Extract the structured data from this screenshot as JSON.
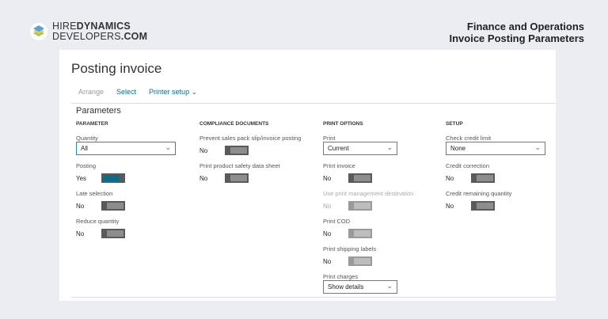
{
  "brand": {
    "line1_light": "HIRE",
    "line1_bold": "DYNAMICS",
    "line2_light": "DEVELOPERS",
    "line2_bold": ".COM"
  },
  "header": {
    "line1": "Finance and Operations",
    "line2": "Invoice Posting Parameters"
  },
  "page": {
    "title": "Posting invoice",
    "section": "Parameters"
  },
  "toolbar": {
    "arrange": "Arrange",
    "select": "Select",
    "printer_setup": "Printer setup"
  },
  "columns": [
    {
      "header": "PARAMETER",
      "fields": [
        {
          "label": "Quantity",
          "type": "dropdown",
          "value": "All"
        },
        {
          "label": "Posting",
          "type": "toggle",
          "value": "Yes"
        },
        {
          "label": "Late selection",
          "type": "toggle",
          "value": "No"
        },
        {
          "label": "Reduce quantity",
          "type": "toggle",
          "value": "No"
        }
      ]
    },
    {
      "header": "COMPLIANCE DOCUMENTS",
      "fields": [
        {
          "label": "Prevent sales pack slip/invoice posting",
          "type": "toggle",
          "value": "No"
        },
        {
          "label": "Print product safety data sheet",
          "type": "toggle",
          "value": "No"
        }
      ]
    },
    {
      "header": "PRINT OPTIONS",
      "fields": [
        {
          "label": "Print",
          "type": "dropdown",
          "value": "Current"
        },
        {
          "label": "Print invoice",
          "type": "toggle",
          "value": "No"
        },
        {
          "label": "Use print management destination",
          "type": "toggle",
          "value": "No",
          "disabled": true
        },
        {
          "label": "Print COD",
          "type": "toggle",
          "value": "No"
        },
        {
          "label": "Print shipping labels",
          "type": "toggle",
          "value": "No"
        },
        {
          "label": "Print charges",
          "type": "dropdown",
          "value": "Show details"
        }
      ]
    },
    {
      "header": "SETUP",
      "fields": [
        {
          "label": "Check credit limit",
          "type": "dropdown",
          "value": "None"
        },
        {
          "label": "Credit correction",
          "type": "toggle",
          "value": "No"
        },
        {
          "label": "Credit remaining quantity",
          "type": "toggle",
          "value": "No"
        }
      ]
    }
  ],
  "colors": {
    "accent": "#106e87",
    "toggle_on": "#0a6c8a",
    "background": "#ecedf2"
  }
}
